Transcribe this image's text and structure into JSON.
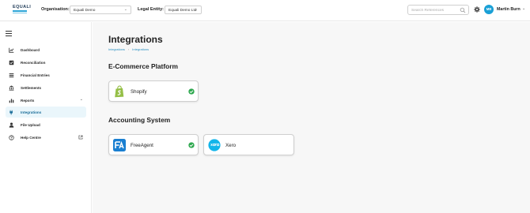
{
  "header": {
    "logo_text": "EQUALI",
    "organisation_label": "Organisation:",
    "organisation_value": "Equali Demo",
    "legal_entity_label": "Legal Entity:",
    "legal_entity_value": "Equali Demo Ltd",
    "search_placeholder": "Search References",
    "user_initials": "MB",
    "user_name": "Martin Burn"
  },
  "sidebar": {
    "items": [
      {
        "label": "Dashboard",
        "icon": "chart-icon"
      },
      {
        "label": "Reconciliation",
        "icon": "checkbox-icon"
      },
      {
        "label": "Financial Entries",
        "icon": "list-icon"
      },
      {
        "label": "Settlements",
        "icon": "bank-icon"
      },
      {
        "label": "Reports",
        "icon": "bar-chart-icon",
        "trailing": "chevron-down-icon"
      },
      {
        "label": "Integrations",
        "icon": "plug-icon",
        "active": true
      },
      {
        "label": "File Upload",
        "icon": "upload-icon"
      },
      {
        "label": "Help Centre",
        "icon": "help-icon",
        "trailing": "external-link-icon"
      }
    ]
  },
  "main": {
    "title": "Integrations",
    "breadcrumb": [
      "Integrations",
      "Integrations"
    ],
    "sections": [
      {
        "title": "E-Commerce Platform",
        "cards": [
          {
            "name": "Shopify",
            "connected": true
          }
        ]
      },
      {
        "title": "Accounting System",
        "cards": [
          {
            "name": "FreeAgent",
            "connected": true
          },
          {
            "name": "Xero",
            "connected": false
          }
        ]
      }
    ]
  },
  "colors": {
    "accent": "#2ea6d8",
    "check_green": "#2fa84f",
    "shopify_green": "#95bf47",
    "freeagent_blue": "#1a7fd1",
    "xero_blue": "#13b5ea"
  }
}
